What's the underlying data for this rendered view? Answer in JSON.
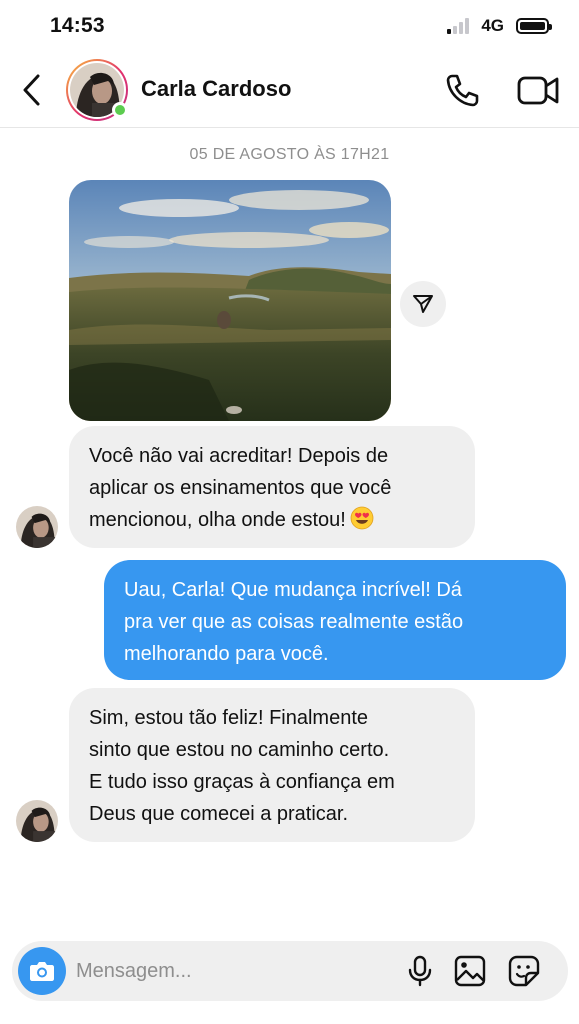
{
  "status_bar": {
    "time": "14:53",
    "network": "4G"
  },
  "header": {
    "contact_name": "Carla Cardoso"
  },
  "chat": {
    "date_separator": "05 DE AGOSTO ÀS 17H21",
    "messages": [
      {
        "direction": "incoming",
        "lines": [
          "Você não vai acreditar! Depois de",
          "aplicar os ensinamentos que você",
          "mencionou, olha onde estou!"
        ],
        "emoji": "smiling-face-with-heart-eyes"
      },
      {
        "direction": "outgoing",
        "lines": [
          "Uau, Carla! Que mudança incrível! Dá",
          "pra ver que as coisas realmente estão",
          "melhorando para você."
        ]
      },
      {
        "direction": "incoming",
        "lines": [
          "Sim, estou tão feliz! Finalmente",
          "sinto que estou no caminho certo.",
          "E tudo isso graças à confiança em",
          "Deus que comecei a praticar."
        ]
      }
    ]
  },
  "composer": {
    "placeholder": "Mensagem..."
  },
  "colors": {
    "outgoing_bubble": "#3797f0",
    "incoming_bubble": "#efefef",
    "online": "#5ccc4f"
  }
}
